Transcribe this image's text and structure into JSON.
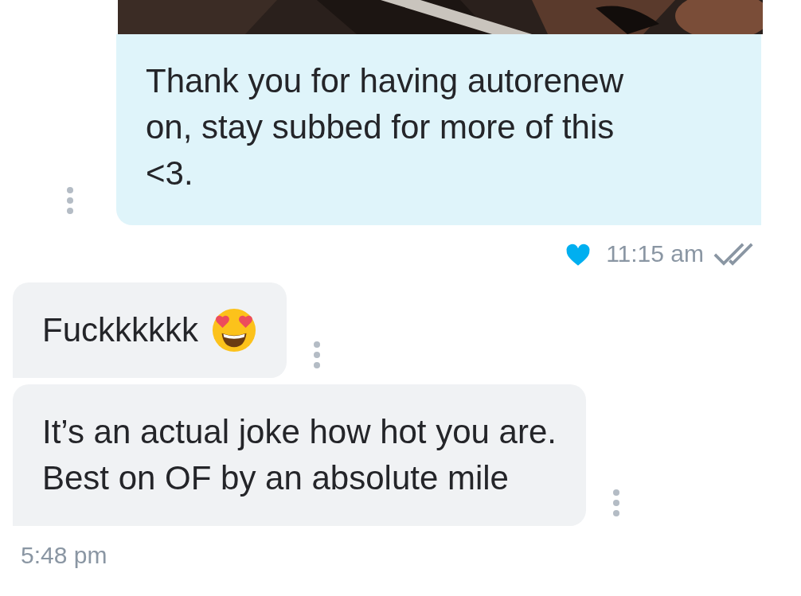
{
  "messages": [
    {
      "kind": "outgoing",
      "text": "Thank you for having autorenew\non, stay subbed for more of this\n<3.",
      "liked": true,
      "time": "11:15 am",
      "read": true
    },
    {
      "kind": "incoming",
      "text": "Fuckkkkkk",
      "emoji": true
    },
    {
      "kind": "incoming",
      "text": "It’s an actual joke how hot you are.\nBest on OF by an absolute mile",
      "time": "5:48 pm"
    }
  ]
}
